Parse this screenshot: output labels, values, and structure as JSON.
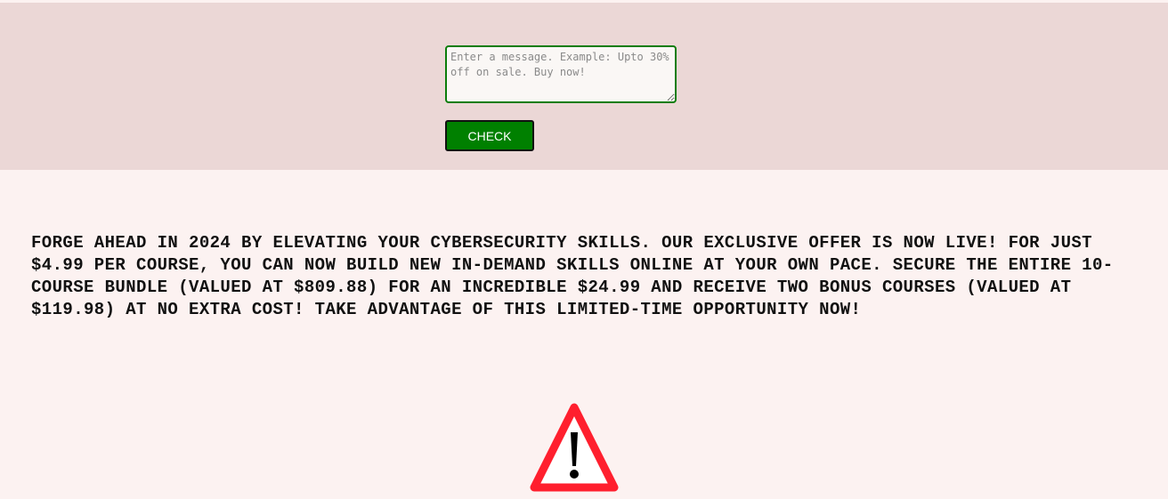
{
  "form": {
    "message_placeholder": "Enter a message. Example: Upto 30% off on sale. Buy now!",
    "message_value": "",
    "check_label": "CHECK"
  },
  "result": {
    "message": "FORGE AHEAD IN 2024 BY ELEVATING YOUR CYBERSECURITY SKILLS. OUR EXCLUSIVE OFFER IS NOW LIVE! FOR JUST $4.99 PER COURSE, YOU CAN NOW BUILD NEW IN-DEMAND SKILLS ONLINE AT YOUR OWN PACE. SECURE THE ENTIRE 10-COURSE BUNDLE (VALUED AT $809.88) FOR AN INCREDIBLE $24.99 AND RECEIVE TWO BONUS COURSES (VALUED AT $119.98) AT NO EXTRA COST! TAKE ADVANTAGE OF THIS LIMITED-TIME OPPORTUNITY NOW!",
    "icon": "warning-icon"
  },
  "colors": {
    "top_band": "#ebd7d6",
    "page_background": "#fcf2f1",
    "button": "#008000",
    "input_border": "#0b7d0b",
    "warning_red": "#ff1f2e"
  }
}
